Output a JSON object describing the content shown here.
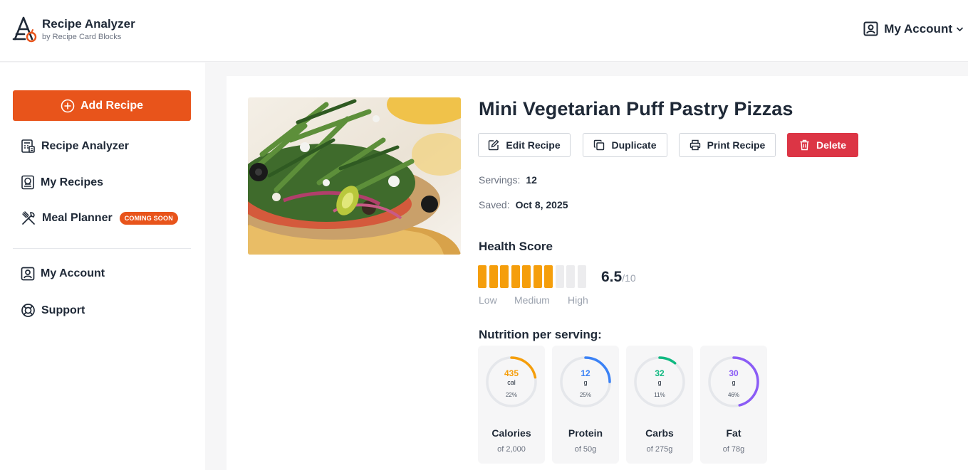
{
  "header": {
    "app_title": "Recipe Analyzer",
    "app_subtitle": "by Recipe Card Blocks",
    "account_label": "My Account"
  },
  "sidebar": {
    "add_button": "Add Recipe",
    "items": [
      {
        "label": "Recipe Analyzer",
        "icon": "calculator-icon"
      },
      {
        "label": "My Recipes",
        "icon": "recipe-book-icon"
      },
      {
        "label": "Meal Planner",
        "icon": "utensils-icon",
        "badge": "COMING SOON"
      },
      {
        "label": "My Account",
        "icon": "user-square-icon"
      },
      {
        "label": "Support",
        "icon": "lifebuoy-icon"
      }
    ]
  },
  "recipe": {
    "title": "Mini Vegetarian Puff Pastry Pizzas",
    "actions": {
      "edit": "Edit Recipe",
      "duplicate": "Duplicate",
      "print": "Print Recipe",
      "delete": "Delete"
    },
    "servings_label": "Servings:",
    "servings": "12",
    "saved_label": "Saved:",
    "saved": "Oct 8, 2025"
  },
  "health": {
    "title": "Health Score",
    "score": "6.5",
    "max": "/10",
    "filled_bars": 7,
    "total_bars": 10,
    "scale": [
      "Low",
      "Medium",
      "High"
    ]
  },
  "nutrition": {
    "title": "Nutrition per serving:",
    "items": [
      {
        "name": "Calories",
        "value": "435",
        "unit": "cal",
        "pct": "22%",
        "fraction": 0.22,
        "of": "of 2,000",
        "color": "#f59e0b"
      },
      {
        "name": "Protein",
        "value": "12",
        "unit": "g",
        "pct": "25%",
        "fraction": 0.25,
        "of": "of 50g",
        "color": "#3b82f6"
      },
      {
        "name": "Carbs",
        "value": "32",
        "unit": "g",
        "pct": "11%",
        "fraction": 0.11,
        "of": "of 275g",
        "color": "#10b981"
      },
      {
        "name": "Fat",
        "value": "30",
        "unit": "g",
        "pct": "46%",
        "fraction": 0.46,
        "of": "of 78g",
        "color": "#8b5cf6"
      }
    ]
  },
  "colors": {
    "accent": "#e8541b",
    "danger": "#dc3545",
    "score_fill": "#f59e0b",
    "score_empty": "#ececee"
  }
}
